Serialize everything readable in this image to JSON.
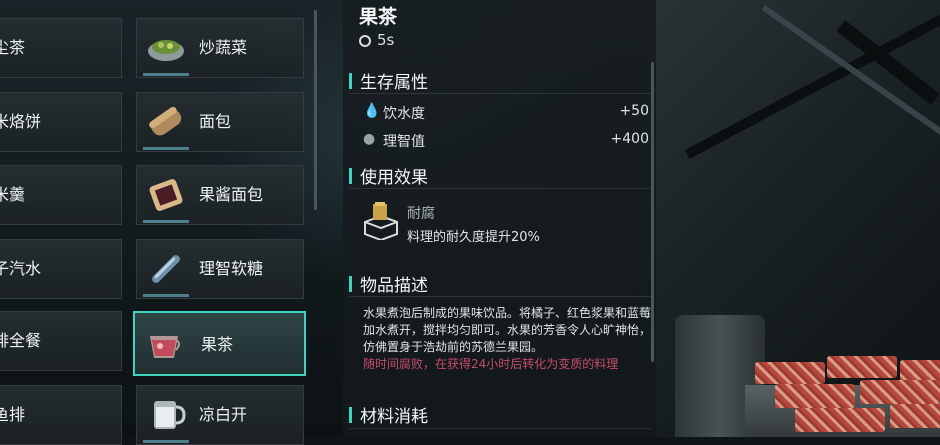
{
  "items_grid": {
    "left_column": [
      {
        "label": "星尘茶",
        "icon": "tea-icon"
      },
      {
        "label": "玉米烙饼",
        "icon": "corn-pancake-icon"
      },
      {
        "label": "玉米羹",
        "icon": "corn-soup-icon"
      },
      {
        "label": "橘子汽水",
        "icon": "soda-icon"
      },
      {
        "label": "牛排全餐",
        "icon": "steak-icon"
      },
      {
        "label": "煎鱼排",
        "icon": "fish-fillet-icon"
      }
    ],
    "right_column": [
      {
        "label": "炒蔬菜",
        "icon": "stir-fry-icon"
      },
      {
        "label": "面包",
        "icon": "bread-icon"
      },
      {
        "label": "果酱面包",
        "icon": "jam-bread-icon"
      },
      {
        "label": "理智软糖",
        "icon": "candy-icon"
      },
      {
        "label": "果茶",
        "icon": "fruit-tea-icon",
        "selected": true
      },
      {
        "label": "凉白开",
        "icon": "water-mug-icon"
      }
    ]
  },
  "detail": {
    "title": "果茶",
    "craft_time": "5s",
    "survival_header": "生存属性",
    "stats": [
      {
        "label": "饮水度",
        "value": "+50",
        "icon": "water-drop-icon"
      },
      {
        "label": "理智值",
        "value": "+400",
        "icon": "brain-icon"
      }
    ],
    "effect_header": "使用效果",
    "effect": {
      "name": "耐腐",
      "desc": "料理的耐久度提升20%",
      "icon": "preserve-box-icon"
    },
    "description_header": "物品描述",
    "description": "水果煮泡后制成的果味饮品。将橘子、红色浆果和蓝莓加水煮开，搅拌均匀即可。水果的芳香令人心旷神怡，仿佛置身于浩劫前的苏德兰果园。",
    "description_warning": "随时间腐败，在获得24小时后转化为变质的料理",
    "materials_header": "材料消耗"
  },
  "colors": {
    "accent": "#3fd4c0",
    "warning": "#e4557a"
  }
}
